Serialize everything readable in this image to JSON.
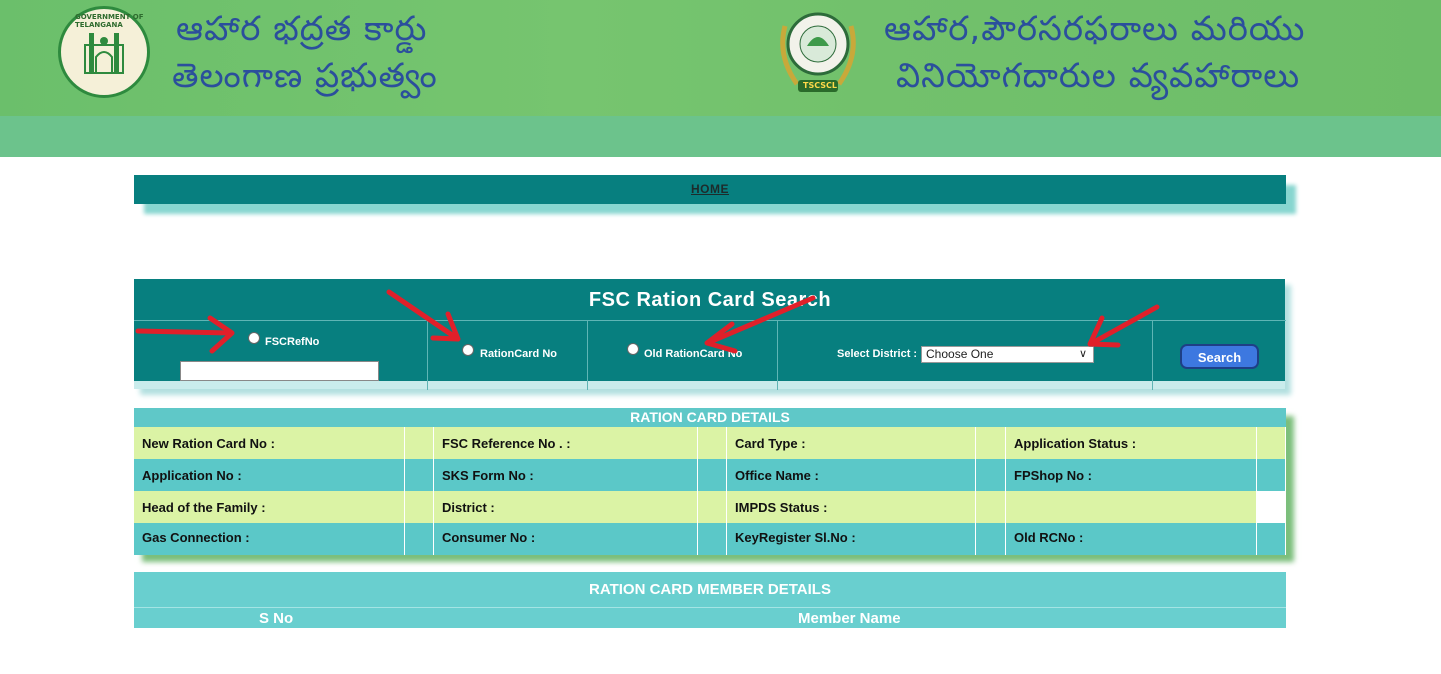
{
  "header": {
    "left_title_line1": "ఆహార భద్రత కార్డు",
    "left_title_line2": "తెలంగాణ ప్రభుత్వం",
    "right_title_line1": "ఆహార,పౌరసరఫరాలు మరియు",
    "right_title_line2": "వినియోగదారుల వ్యవహారాలు",
    "emblem_text": "GOVERNMENT OF TELANGANA",
    "logo_badge": "TSCSCL"
  },
  "nav": {
    "home_label": "HOME"
  },
  "search": {
    "title": "FSC Ration Card Search",
    "option_fscref": "FSCRefNo",
    "option_rationcard": "RationCard No",
    "option_old_rationcard": "Old RationCard No",
    "district_label": "Select District :",
    "district_selected": "Choose One",
    "search_button": "Search"
  },
  "details": {
    "title": "RATION CARD DETAILS",
    "rows": [
      [
        "New Ration Card No :",
        "FSC Reference No . :",
        "Card Type :",
        "Application Status :"
      ],
      [
        "Application No :",
        "SKS Form No :",
        "Office Name :",
        "FPShop No :"
      ],
      [
        "Head of the Family :",
        "District :",
        "IMPDS Status :",
        ""
      ],
      [
        "Gas Connection :",
        "Consumer No :",
        "KeyRegister Sl.No :",
        "Old RCNo :"
      ]
    ]
  },
  "members": {
    "title": "RATION CARD MEMBER DETAILS",
    "col_sno": "S No",
    "col_name": "Member Name"
  },
  "colors": {
    "banner_green": "#72c16c",
    "teal_dark": "#077f7f",
    "teal_light": "#5bc8c8",
    "row_yellow": "#dbf3a5",
    "button_blue": "#3d78e0",
    "annotation_arrow": "#e0202a"
  }
}
